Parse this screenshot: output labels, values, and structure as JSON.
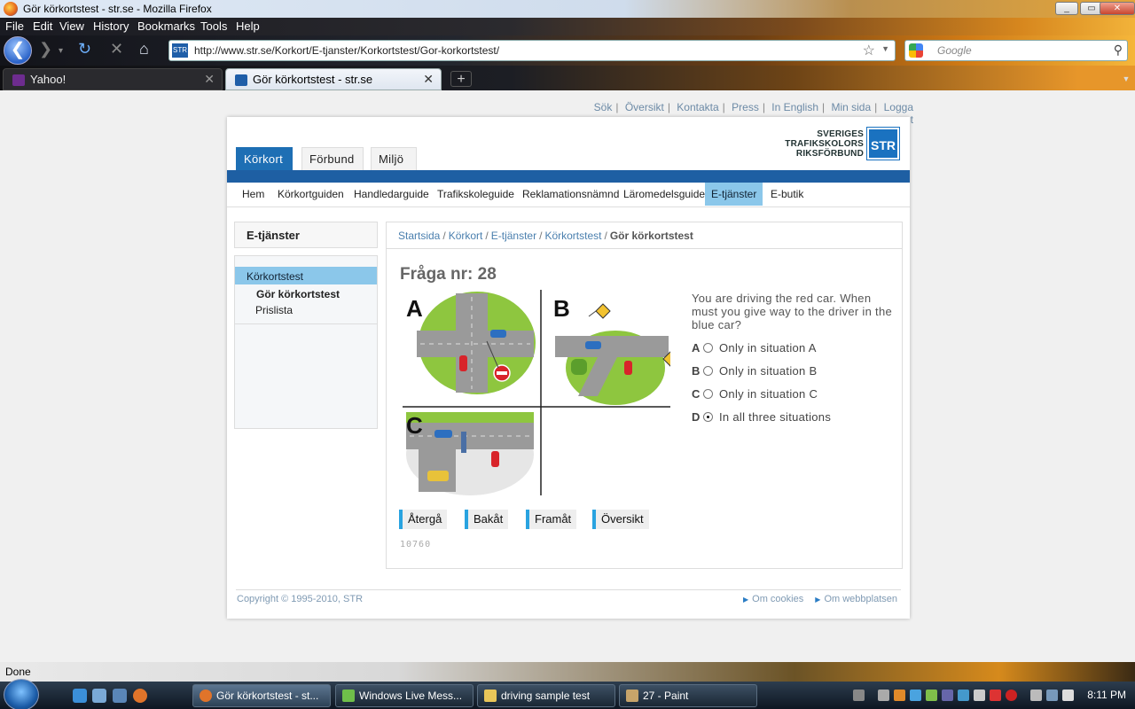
{
  "window": {
    "title": "Gör körkortstest - str.se - Mozilla Firefox",
    "controls": [
      "_",
      "▭",
      "✕"
    ]
  },
  "menu": [
    "File",
    "Edit",
    "View",
    "History",
    "Bookmarks",
    "Tools",
    "Help"
  ],
  "nav": {
    "url": "http://www.str.se/Korkort/E-tjanster/Korkortstest/Gor-korkortstest/",
    "site_icon_text": "STR",
    "search_placeholder": "Google"
  },
  "tabs": [
    {
      "label": "Yahoo!",
      "icon": "yahoo-icon"
    },
    {
      "label": "Gör körkortstest - str.se",
      "icon": "str-icon"
    }
  ],
  "utility_links": [
    "Sök",
    "Översikt",
    "Kontakta",
    "Press",
    "In English",
    "Min sida",
    "Logga ut"
  ],
  "logo": {
    "line1": "SVERIGES",
    "line2": "TRAFIKSKOLORS",
    "line3": "RIKSFÖRBUND",
    "mark": "STR"
  },
  "main_tabs": [
    "Körkort",
    "Förbund",
    "Miljö"
  ],
  "sub_nav": [
    "Hem",
    "Körkortguiden",
    "Handledarguide",
    "Trafikskoleguide",
    "Reklamationsnämnd",
    "Läromedelsguide",
    "E-tjänster",
    "E-butik"
  ],
  "sidebar": {
    "header": "E-tjänster",
    "item": "Körkortstest",
    "sub_active": "Gör körkortstest",
    "sub_other": "Prislista"
  },
  "breadcrumb": [
    "Startsida",
    "Körkort",
    "E-tjänster",
    "Körkortstest"
  ],
  "breadcrumb_current": "Gör körkortstest",
  "question": {
    "title": "Fråga nr: 28",
    "text": "You are driving the red car. When must you give way to the driver in the blue car?",
    "figure_labels": [
      "A",
      "B",
      "C"
    ],
    "options": [
      {
        "letter": "A",
        "text": "Only in situation A",
        "selected": false
      },
      {
        "letter": "B",
        "text": "Only in situation B",
        "selected": false
      },
      {
        "letter": "C",
        "text": "Only in situation C",
        "selected": false
      },
      {
        "letter": "D",
        "text": "In all three situations",
        "selected": true
      }
    ],
    "buttons": [
      "Återgå",
      "Bakåt",
      "Framåt",
      "Översikt"
    ],
    "id": "10760"
  },
  "footer": {
    "copyright": "Copyright © 1995-2010, STR",
    "links": [
      "Om cookies",
      "Om webbplatsen"
    ]
  },
  "status": "Done",
  "taskbar": {
    "tasks": [
      "Gör körkortstest - st...",
      "Windows Live Mess...",
      "driving sample test",
      "27 - Paint"
    ],
    "clock": "8:11 PM"
  }
}
